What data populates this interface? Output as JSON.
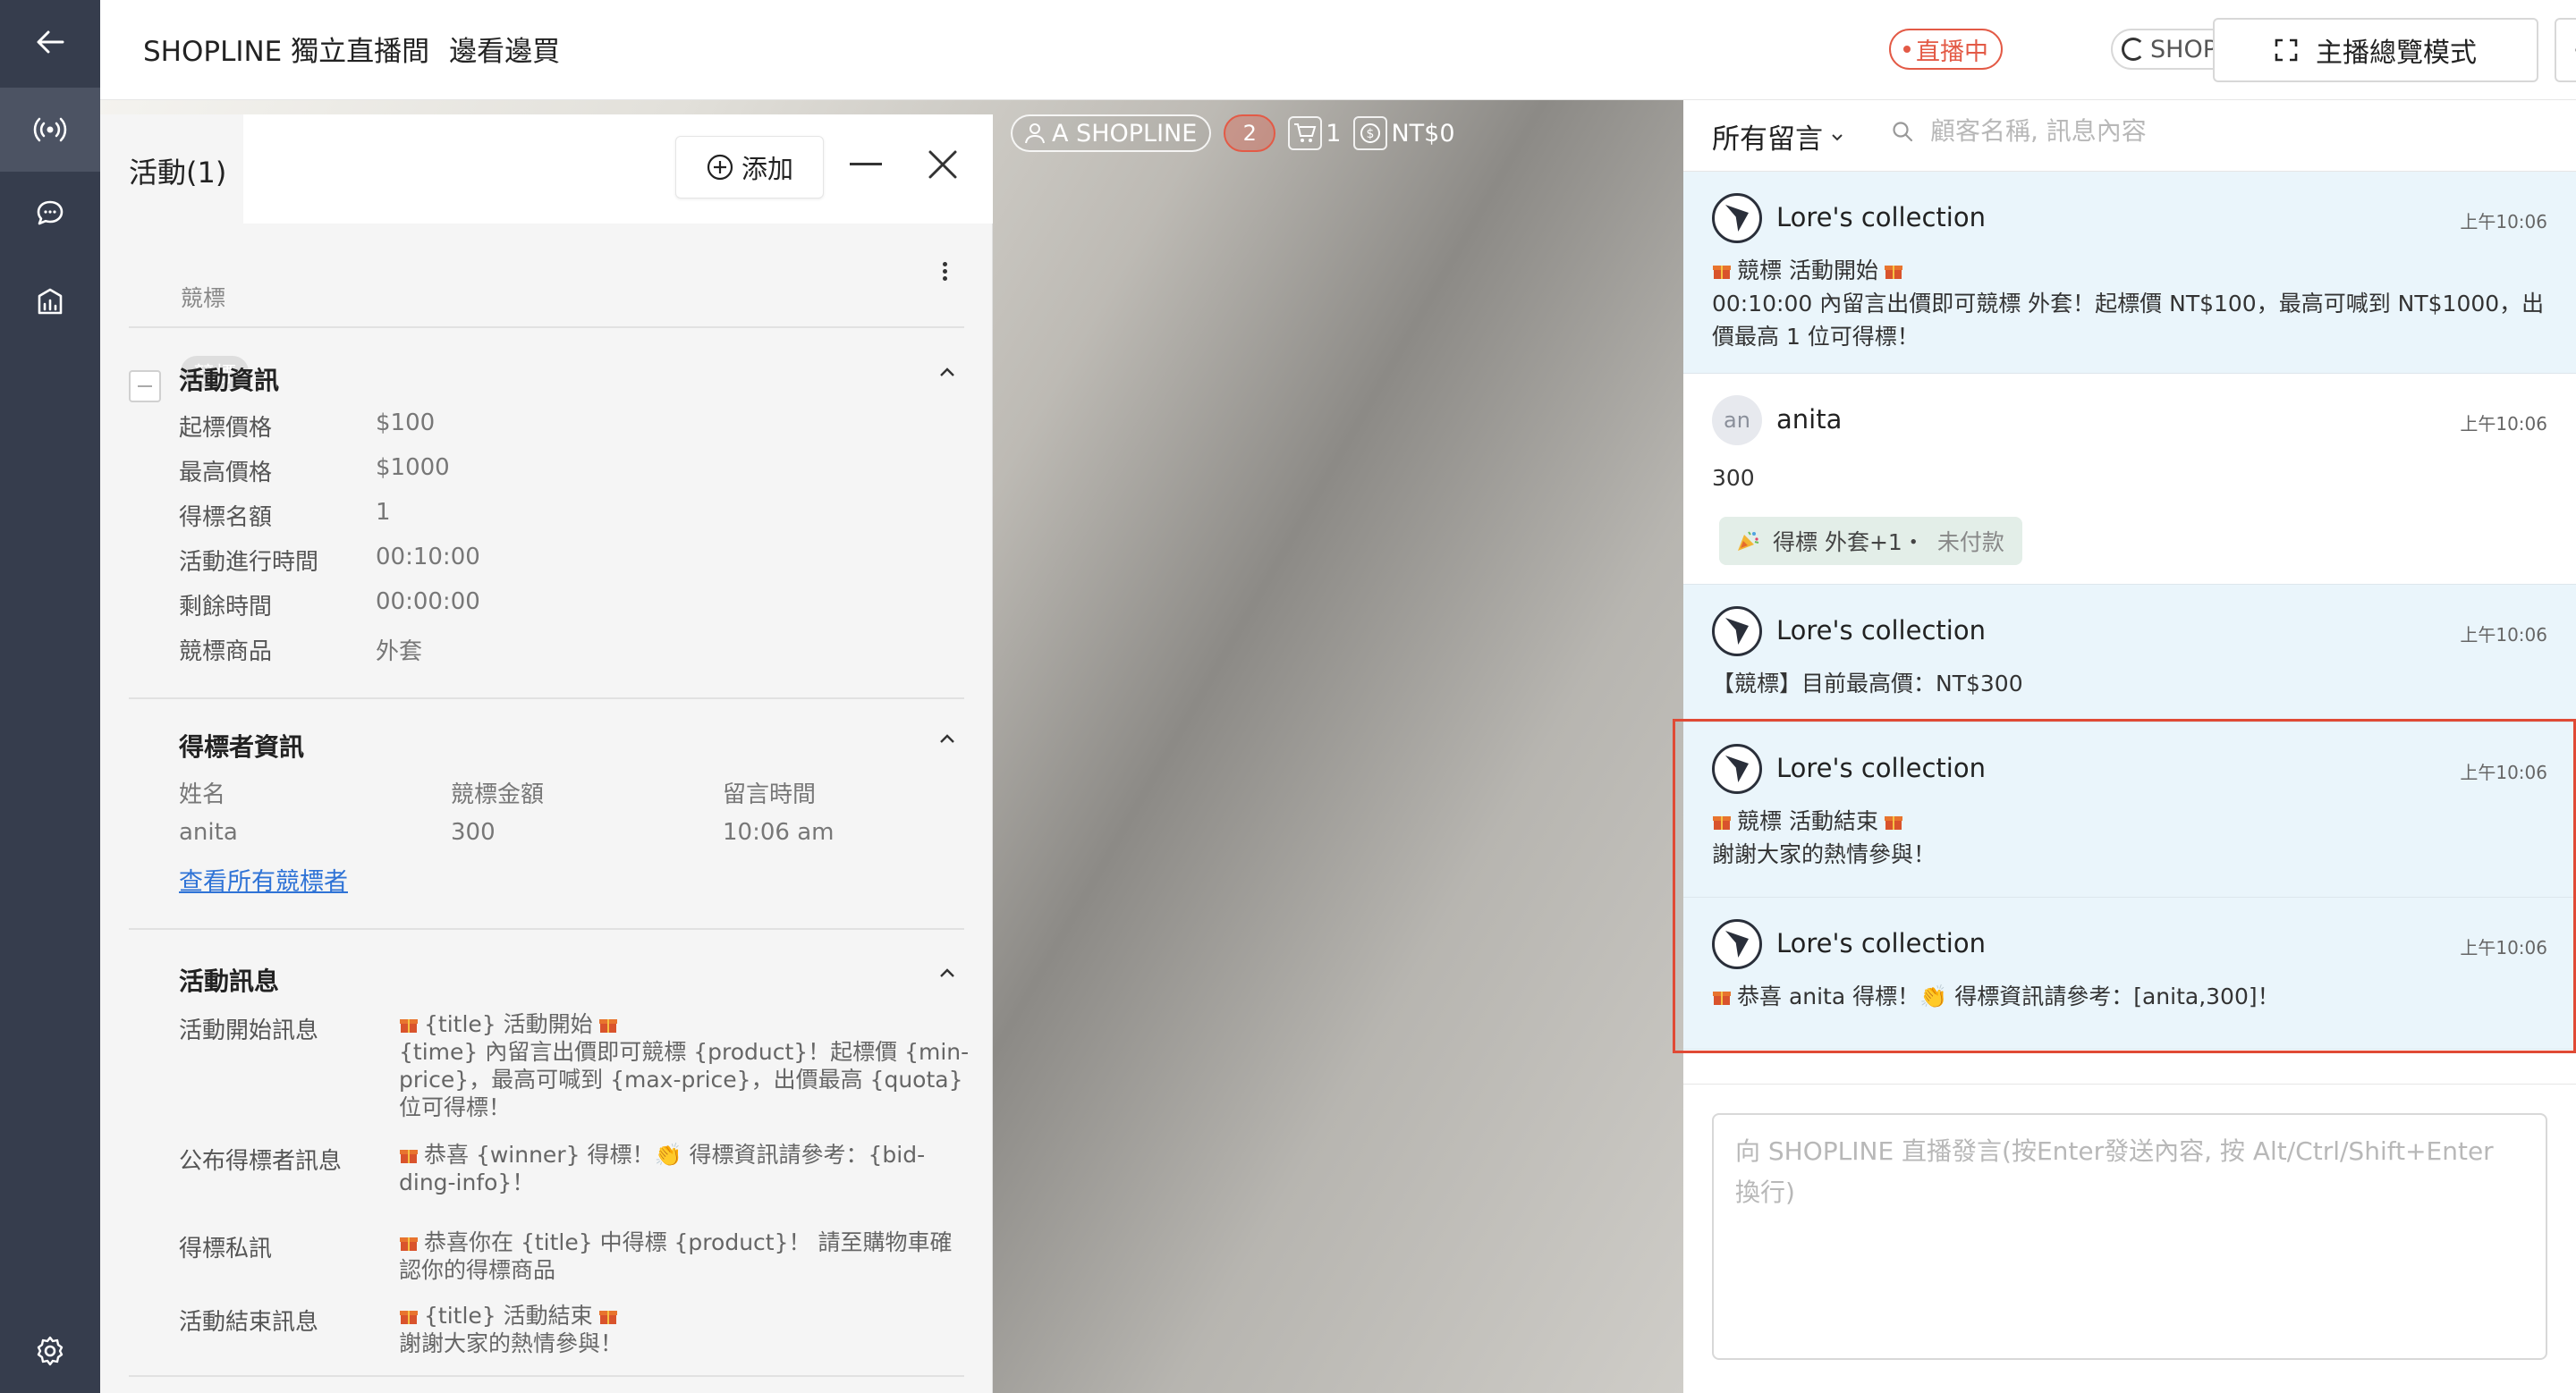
{
  "header": {
    "title_main": "SHOPLINE 獨立直播間",
    "title_sub": "邊看邊買",
    "live_label": "直播中",
    "brand_label": "SHOPLINE",
    "overview_label": "主播總覽模式"
  },
  "video_overlay": {
    "host_label": "A SHOPLINE",
    "viewer_count": "2",
    "cart_count": "1",
    "revenue": "NT$0"
  },
  "activity": {
    "title": "活動(1)",
    "add_label": "添加",
    "tag": "競標",
    "tag_name": "競標",
    "info_section": {
      "title": "活動資訊",
      "rows": [
        {
          "label": "起標價格",
          "value": "$100"
        },
        {
          "label": "最高價格",
          "value": "$1000"
        },
        {
          "label": "得標名額",
          "value": "1"
        },
        {
          "label": "活動進行時間",
          "value": "00:10:00"
        },
        {
          "label": "剩餘時間",
          "value": "00:00:00"
        },
        {
          "label": "競標商品",
          "value": "外套"
        }
      ]
    },
    "winner_section": {
      "title": "得標者資訊",
      "headers": [
        "姓名",
        "競標金額",
        "留言時間"
      ],
      "row": [
        "anita",
        "300",
        "10:06 am"
      ],
      "view_all": "查看所有競標者"
    },
    "message_section": {
      "title": "活動訊息",
      "rows": [
        {
          "label": "活動開始訊息",
          "line1": "{title} 活動開始",
          "line2": "{time} 內留言出價即可競標 {product}！起標價 {min-price}，最高可喊到 {max-price}，出價最高 {quota} 位可得標！"
        },
        {
          "label": "公布得標者訊息",
          "line1": "恭喜 {winner} 得標！👏 得標資訊請參考：{bid-ding-info}！",
          "line2": ""
        },
        {
          "label": "得標私訊",
          "line1": "恭喜你在 {title} 中得標 {product}！ 請至購物車確認你的得標商品",
          "line2": ""
        },
        {
          "label": "活動結束訊息",
          "line1": "{title} 活動結束",
          "line2": "謝謝大家的熱情參與！"
        }
      ]
    }
  },
  "comments": {
    "filter_label": "所有留言",
    "search_placeholder": "顧客名稱, 訊息內容",
    "items": [
      {
        "name": "Lore's collection",
        "time": "上午10:06",
        "line1": "競標 活動開始",
        "line2": "00:10:00 內留言出價即可競標 外套！起標價 NT$100，最高可喊到 NT$1000，出價最高 1 位可得標！"
      },
      {
        "name": "anita",
        "avatar": "an",
        "time": "上午10:06",
        "text": "300",
        "tag": "得標 外套+1・",
        "tag_status": "未付款"
      },
      {
        "name": "Lore's collection",
        "time": "上午10:06",
        "text": "【競標】目前最高價：NT$300"
      },
      {
        "name": "Lore's collection",
        "time": "上午10:06",
        "line1": "競標 活動結束",
        "line2": "謝謝大家的熱情參與！"
      },
      {
        "name": "Lore's collection",
        "time": "上午10:06",
        "text": "恭喜 anita 得標！👏 得標資訊請參考：[anita,300]！"
      }
    ],
    "composer_placeholder": "向 SHOPLINE 直播發言(按Enter發送內容, 按 Alt/Ctrl/Shift+Enter 換行)"
  }
}
